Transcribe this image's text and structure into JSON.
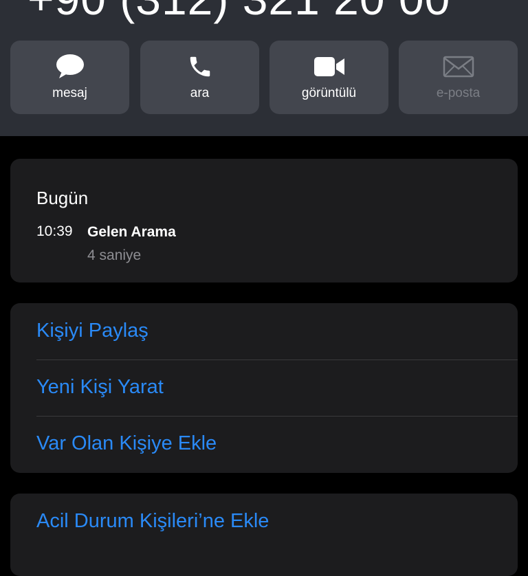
{
  "header": {
    "phone_number": "+90 (312) 321 20 00"
  },
  "actions": [
    {
      "label": "mesaj",
      "icon": "message-bubble-icon",
      "enabled": true
    },
    {
      "label": "ara",
      "icon": "phone-icon",
      "enabled": true
    },
    {
      "label": "görüntülü",
      "icon": "video-camera-icon",
      "enabled": true
    },
    {
      "label": "e-posta",
      "icon": "envelope-icon",
      "enabled": false
    }
  ],
  "history": {
    "day": "Bugün",
    "entries": [
      {
        "time": "10:39",
        "type": "Gelen Arama",
        "duration": "4 saniye"
      }
    ]
  },
  "contact_actions": [
    {
      "label": "Kişiyi Paylaş"
    },
    {
      "label": "Yeni Kişi Yarat"
    },
    {
      "label": "Var Olan Kişiye Ekle"
    }
  ],
  "emergency": {
    "label": "Acil Durum Kişileri’ne Ekle"
  },
  "colors": {
    "header_bg": "#2c2f36",
    "button_bg": "#43464e",
    "card_bg": "#1c1c1e",
    "link_blue": "#2a8af7",
    "secondary_text": "#8e8e93",
    "disabled_text": "#7b7e85"
  }
}
